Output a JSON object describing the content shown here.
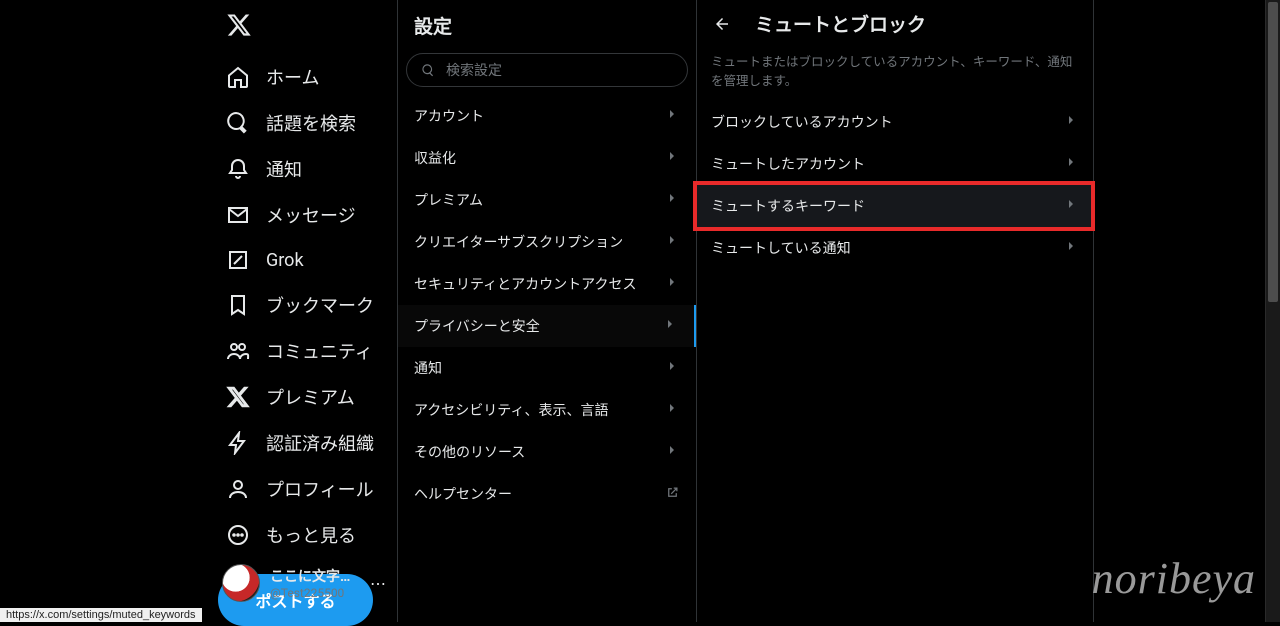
{
  "nav": {
    "items": [
      {
        "key": "home",
        "label": "ホーム"
      },
      {
        "key": "explore",
        "label": "話題を検索"
      },
      {
        "key": "notifications",
        "label": "通知"
      },
      {
        "key": "messages",
        "label": "メッセージ"
      },
      {
        "key": "grok",
        "label": "Grok"
      },
      {
        "key": "bookmarks",
        "label": "ブックマーク"
      },
      {
        "key": "communities",
        "label": "コミュニティ"
      },
      {
        "key": "premium",
        "label": "プレミアム"
      },
      {
        "key": "orgs",
        "label": "認証済み組織"
      },
      {
        "key": "profile",
        "label": "プロフィール"
      },
      {
        "key": "more",
        "label": "もっと見る"
      }
    ],
    "post_label": "ポストする"
  },
  "account": {
    "display_name": "ここに文字を入力しま",
    "handle": "@Test225500"
  },
  "settings": {
    "title": "設定",
    "search_placeholder": "検索設定",
    "items": [
      {
        "label": "アカウント"
      },
      {
        "label": "収益化"
      },
      {
        "label": "プレミアム"
      },
      {
        "label": "クリエイターサブスクリプション"
      },
      {
        "label": "セキュリティとアカウントアクセス"
      },
      {
        "label": "プライバシーと安全",
        "active": true
      },
      {
        "label": "通知"
      },
      {
        "label": "アクセシビリティ、表示、言語"
      },
      {
        "label": "その他のリソース"
      },
      {
        "label": "ヘルプセンター",
        "external": true
      }
    ]
  },
  "detail": {
    "title": "ミュートとブロック",
    "description": "ミュートまたはブロックしているアカウント、キーワード、通知を管理します。",
    "items": [
      {
        "label": "ブロックしているアカウント"
      },
      {
        "label": "ミュートしたアカウント"
      },
      {
        "label": "ミュートするキーワード",
        "highlighted": true
      },
      {
        "label": "ミュートしている通知"
      }
    ]
  },
  "status_url": "https://x.com/settings/muted_keywords",
  "watermark": "noribeya"
}
